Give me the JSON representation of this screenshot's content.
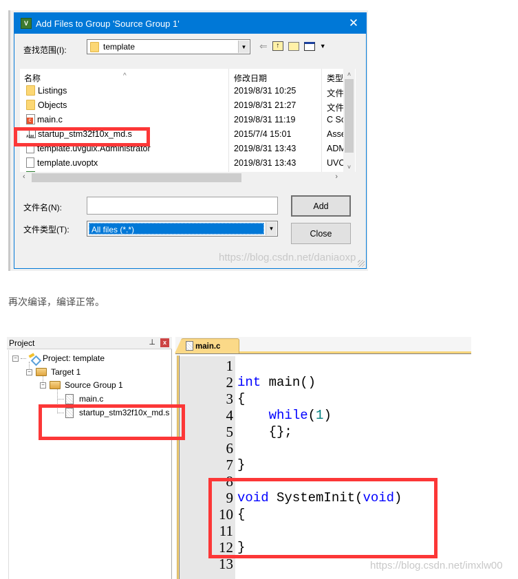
{
  "dialog": {
    "title": "Add Files to Group 'Source Group 1'",
    "app_icon": "uvision-icon",
    "close_glyph": "✕",
    "look_in_label": "查找范围(I):",
    "look_in_value": "template",
    "nav_icons": [
      "back-arrow-icon",
      "up-folder-icon",
      "new-folder-icon",
      "view-menu-icon"
    ],
    "columns": {
      "name": "名称",
      "date": "修改日期",
      "type": "类型"
    },
    "files": [
      {
        "name": "Listings",
        "icon": "folder",
        "date": "2019/8/31 10:25",
        "type": "文件"
      },
      {
        "name": "Objects",
        "icon": "folder",
        "date": "2019/8/31 21:27",
        "type": "文件"
      },
      {
        "name": "main.c",
        "icon": "c-source",
        "date": "2019/8/31 11:19",
        "type": "C Sc"
      },
      {
        "name": "startup_stm32f10x_md.s",
        "icon": "asm",
        "date": "2015/7/4 15:01",
        "type": "Asse"
      },
      {
        "name": "template.uvguix.Administrator",
        "icon": "file",
        "date": "2019/8/31 13:43",
        "type": "ADM"
      },
      {
        "name": "template.uvoptx",
        "icon": "file",
        "date": "2019/8/31 13:43",
        "type": "UVC"
      }
    ],
    "file_name_label": "文件名(N):",
    "file_name_value": "",
    "file_type_label": "文件类型(T):",
    "file_type_value": "All files (*.*)",
    "add_button": "Add",
    "close_button": "Close",
    "watermark": "https://blog.csdn.net/daniaoxp"
  },
  "caption": "再次编译，编译正常。",
  "ide": {
    "project_panel_title": "Project",
    "pin_glyph": "ᵖ",
    "close_glyph": "x",
    "tree": [
      {
        "label": "Project: template",
        "level": 0,
        "icon": "project"
      },
      {
        "label": "Target 1",
        "level": 1,
        "icon": "target-folder"
      },
      {
        "label": "Source Group 1",
        "level": 2,
        "icon": "folder"
      },
      {
        "label": "main.c",
        "level": 3,
        "icon": "file"
      },
      {
        "label": "startup_stm32f10x_md.s",
        "level": 3,
        "icon": "file"
      }
    ],
    "active_tab": "main.c",
    "code_lines": [
      {
        "n": "1",
        "tokens": []
      },
      {
        "n": "2",
        "tokens": [
          {
            "t": "int",
            "c": "kw"
          },
          {
            "t": " main()",
            "c": ""
          }
        ]
      },
      {
        "n": "3",
        "tokens": [
          {
            "t": "{",
            "c": ""
          }
        ]
      },
      {
        "n": "4",
        "tokens": [
          {
            "t": "    ",
            "c": ""
          },
          {
            "t": "while",
            "c": "kw"
          },
          {
            "t": "(",
            "c": ""
          },
          {
            "t": "1",
            "c": "num"
          },
          {
            "t": ")",
            "c": ""
          }
        ]
      },
      {
        "n": "5",
        "tokens": [
          {
            "t": "    {};",
            "c": ""
          }
        ]
      },
      {
        "n": "6",
        "tokens": []
      },
      {
        "n": "7",
        "tokens": [
          {
            "t": "}",
            "c": ""
          }
        ]
      },
      {
        "n": "8",
        "tokens": []
      },
      {
        "n": "9",
        "tokens": [
          {
            "t": "void",
            "c": "kw"
          },
          {
            "t": " SystemInit(",
            "c": ""
          },
          {
            "t": "void",
            "c": "kw"
          },
          {
            "t": ")",
            "c": ""
          }
        ]
      },
      {
        "n": "10",
        "tokens": [
          {
            "t": "{",
            "c": ""
          }
        ]
      },
      {
        "n": "11",
        "tokens": []
      },
      {
        "n": "12",
        "tokens": [
          {
            "t": "}",
            "c": ""
          }
        ]
      },
      {
        "n": "13",
        "tokens": []
      }
    ],
    "watermark": "https://blog.csdn.net/imxlw00"
  },
  "colors": {
    "title_bar": "#0078d7",
    "highlight_box": "#fc3737",
    "keyword": "#0000ff",
    "number": "#008080",
    "tab": "#fbd988"
  }
}
